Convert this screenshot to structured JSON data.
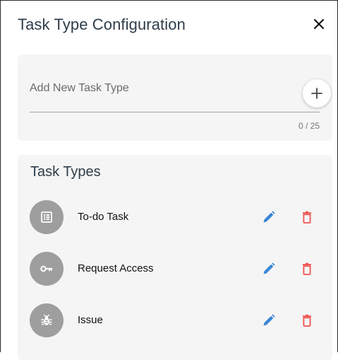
{
  "dialog": {
    "title": "Task Type Configuration",
    "close_icon": "close-icon"
  },
  "add_task_type": {
    "placeholder": "Add New Task Type",
    "value": "",
    "counter": "0 / 25",
    "add_icon": "plus-icon"
  },
  "task_types": {
    "heading": "Task Types",
    "items": [
      {
        "label": "To-do Task",
        "icon": "list-icon"
      },
      {
        "label": "Request Access",
        "icon": "key-icon"
      },
      {
        "label": "Issue",
        "icon": "bug-icon"
      }
    ],
    "edit_icon": "pencil-icon",
    "delete_icon": "trash-icon"
  },
  "colors": {
    "avatar": "#9e9e9e",
    "edit": "#3a85d6",
    "delete": "#ef5350",
    "card": "#f5f5f5",
    "title": "#2f3d4a"
  }
}
